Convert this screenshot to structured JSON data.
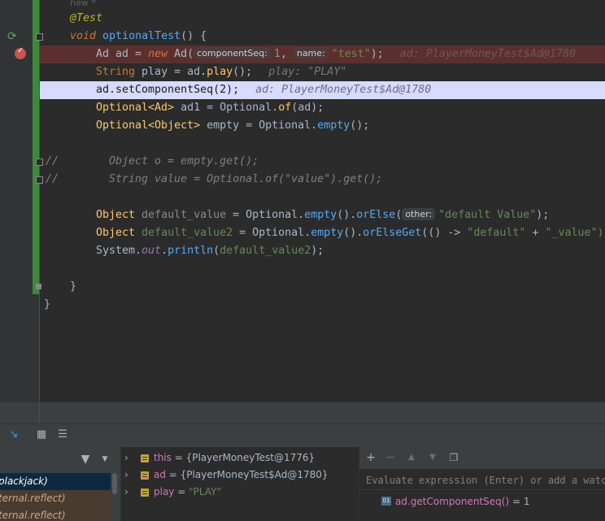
{
  "editor": {
    "line_new": "new *",
    "line_test": "@Test",
    "line_void": "void",
    "method_name": "optionalTest",
    "method_tail": "() {",
    "ad_type": "Ad ",
    "ad_var": "ad",
    "ad_eq": " = ",
    "kw_new": "new",
    "ad_ctor": " Ad(",
    "hint_componentSeq": "componentSeq:",
    "num_one": "1",
    "comma_space": ", ",
    "hint_name": "name:",
    "str_test": "\"test\"",
    "close_semicolon": ");",
    "dbg_ad": "ad: PlayerMoneyTest$Ad@1780",
    "play_type": "String ",
    "play_var": "play",
    "play_eq": " = ",
    "play_ref": "ad",
    "play_call": ".play",
    "play_tail": "();",
    "dbg_play": "play: \"PLAY\"",
    "set_line": "ad.setComponentSeq(2);",
    "dbg_ad2": "ad: PlayerMoneyTest$Ad@1780",
    "opt_ad_line_1": "Optional<Ad> ",
    "opt_ad_var": "ad1",
    "opt_ad_line_2": " = Optional.",
    "opt_of": "of",
    "opt_ad_line_3": "(",
    "opt_ad_arg": "ad",
    "opt_ad_line_4": ");",
    "opt_obj_line_1": "Optional<Object> ",
    "opt_obj_var": "empty",
    "opt_obj_line_2": " = Optional.",
    "opt_empty": "empty",
    "opt_obj_line_3": "();",
    "comment_1a": "//",
    "comment_1b": "Object o = empty.get();",
    "comment_2a": "//",
    "comment_2b": "String value = Optional.of(\"value\").get();",
    "dv_type": "Object ",
    "dv_var": "default_value",
    "dv_eq": " = Optional.",
    "dv_empty": "empty",
    "dv_paren": "().",
    "dv_orElse": "orElse",
    "dv_open": "(",
    "hint_other": "other:",
    "str_default_value": "\"default Value\"",
    "dv_close": ");",
    "dv2_type": "Object ",
    "dv2_var": "default_value2",
    "dv2_eq": " = Optional.",
    "dv2_empty": "empty",
    "dv2_paren": "().",
    "dv2_orElseGet": "orElseGet",
    "dv2_lambda": "(() -> ",
    "str_default": "\"default\"",
    "dv2_plus": " + ",
    "str_value_suffix": "\"_value\")",
    "print_1": "System.",
    "print_out": "out",
    "print_2": ".",
    "print_fn": "println",
    "print_3": "(",
    "print_arg": "default_value2",
    "print_4": ");",
    "close_method": "}",
    "close_class": "}"
  },
  "frames": {
    "items": [
      {
        "label": "plackjack)"
      },
      {
        "label": "ternal.reflect)"
      },
      {
        "label": "ternal.reflect)"
      }
    ]
  },
  "variables": {
    "items": [
      {
        "name": "this",
        "eq": " = ",
        "value": "{PlayerMoneyTest@1776}"
      },
      {
        "name": "ad",
        "eq": " = ",
        "value": "{PlayerMoneyTest$Ad@1780}"
      },
      {
        "name": "play",
        "eq": " = ",
        "value": "\"PLAY\""
      }
    ]
  },
  "watches": {
    "placeholder": "Evaluate expression (Enter) or add a watch",
    "items": [
      {
        "expr": "ad.getComponentSeq()",
        "eq": " = ",
        "value": "1"
      }
    ]
  },
  "icons": {
    "run": "run-gutter-icon",
    "breakpoint": "breakpoint-icon",
    "filter": "filter-icon",
    "add": "plus-icon",
    "remove": "minus-icon",
    "up": "arrow-up-icon",
    "down": "arrow-down-icon",
    "duplicate": "duplicate-icon"
  },
  "colors": {
    "keyword": "#cc7832",
    "annotation": "#bbb529",
    "method": "#ffc66d",
    "string": "#6a8759",
    "number": "#6897bb",
    "field": "#9876aa",
    "breakpoint_line": "#5c2f2f",
    "execution_line": "#d6dbff"
  }
}
